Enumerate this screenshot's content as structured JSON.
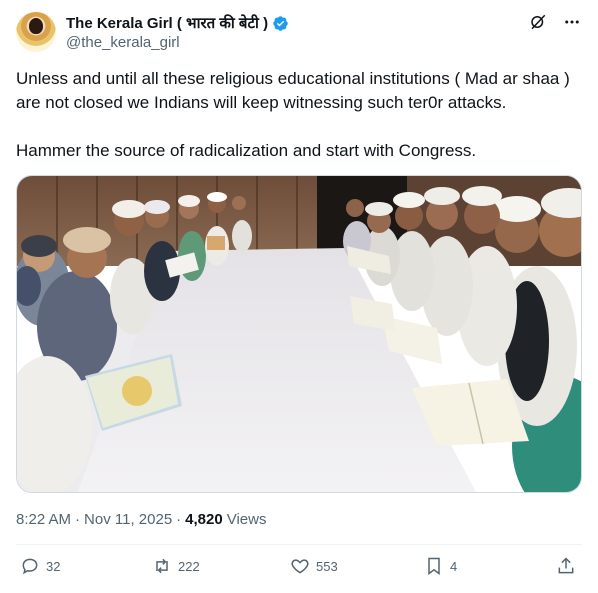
{
  "author": {
    "name": "The Kerala Girl ( भारत की बेटी )",
    "handle": "@the_kerala_girl",
    "verified_icon": "verified-badge-icon",
    "accent": "#1d9bf0"
  },
  "header_icons": [
    "grok-icon",
    "more-icon"
  ],
  "tweet": {
    "text": "Unless and until all these religious educational institutions ( Mad ar shaa ) are not closed we Indians will keep witnessing such ter0r attacks.\n\nHammer the source of radicalization and start with Congress."
  },
  "meta": {
    "time": "8:22 AM",
    "date": "Nov 11, 2025",
    "views_count": "4,820",
    "views_label": "Views"
  },
  "actions": {
    "replies": "32",
    "reposts": "222",
    "likes": "553",
    "bookmarks": "4"
  }
}
